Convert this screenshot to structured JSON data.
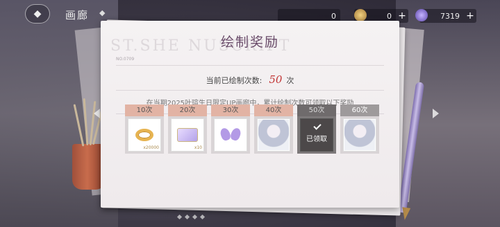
{
  "header": {
    "back_icon": "back-ornament-icon",
    "page_title": "画廊"
  },
  "currencies": [
    {
      "icon": "unknown-currency-icon",
      "amount": "0",
      "plus": "+"
    },
    {
      "icon": "coin-icon",
      "amount": "0",
      "plus": "+"
    },
    {
      "icon": "gem-icon",
      "amount": "7319",
      "plus": "+"
    }
  ],
  "card": {
    "watermark": "ST.SHE              NUSCRIPT",
    "serial": "NO.0709",
    "title": "绘制奖励",
    "count_label": "当前已绘制次数:",
    "count_value": "50",
    "count_unit": "次",
    "description": "在当期2025叶瑄生日限定UP画廊中，累计绘制次数可领取以下奖励",
    "rewards": [
      {
        "label": "10次",
        "icon": "ring-icon",
        "qty": "x20000",
        "state": "unclaimed"
      },
      {
        "label": "20次",
        "icon": "ticket-icon",
        "qty": "x10",
        "state": "unclaimed"
      },
      {
        "label": "30次",
        "icon": "butterfly-icon",
        "qty": "",
        "state": "unclaimed"
      },
      {
        "label": "40次",
        "icon": "portrait-icon",
        "qty": "",
        "state": "unclaimed"
      },
      {
        "label": "50次",
        "icon": "check-icon",
        "qty": "",
        "state": "claimed",
        "claimed_text": "已领取"
      },
      {
        "label": "60次",
        "icon": "portrait-icon",
        "qty": "",
        "state": "next"
      }
    ]
  },
  "colors": {
    "title": "#6a4c6a",
    "count_value": "#c23636",
    "reward_label_bg": "#e2b3a4",
    "claimed_bg": "#7d797a"
  }
}
